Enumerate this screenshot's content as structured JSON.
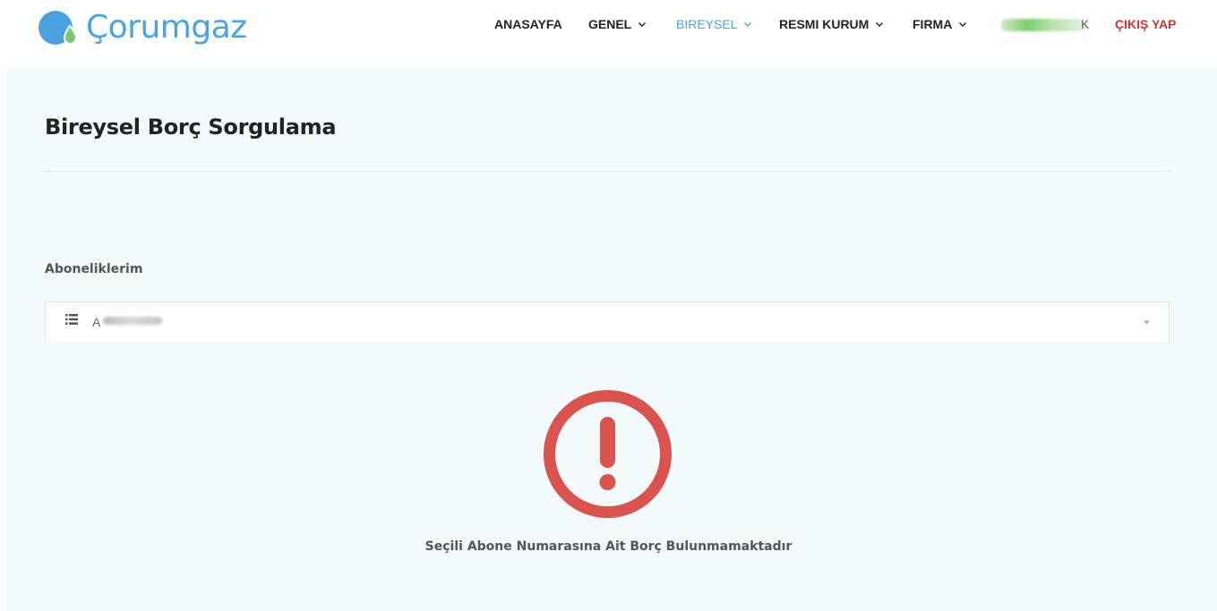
{
  "brand": {
    "name": "Çorumgaz",
    "primary_color": "#4aa3df",
    "accent_green": "#7cc576"
  },
  "nav": {
    "items": [
      {
        "label": "ANASAYFA",
        "dropdown": false
      },
      {
        "label": "GENEL",
        "dropdown": true
      },
      {
        "label": "BIREYSEL",
        "dropdown": true,
        "active": true
      },
      {
        "label": "RESMI KURUM",
        "dropdown": true
      },
      {
        "label": "FIRMA",
        "dropdown": true
      }
    ],
    "user_suffix": "K",
    "logout_label": "ÇIKIŞ YAP",
    "logout_color": "#d63031"
  },
  "page": {
    "title": "Bireysel Borç Sorgulama",
    "subscriptions_label": "Aboneliklerim",
    "selected_subscription": "A",
    "select_icon": "list-icon",
    "caret_icon": "chevron-down-icon"
  },
  "result": {
    "icon": "exclamation-circle-icon",
    "icon_color": "#d9534f",
    "message": "Seçili Abone Numarasına Ait Borç Bulunmamaktadır"
  }
}
